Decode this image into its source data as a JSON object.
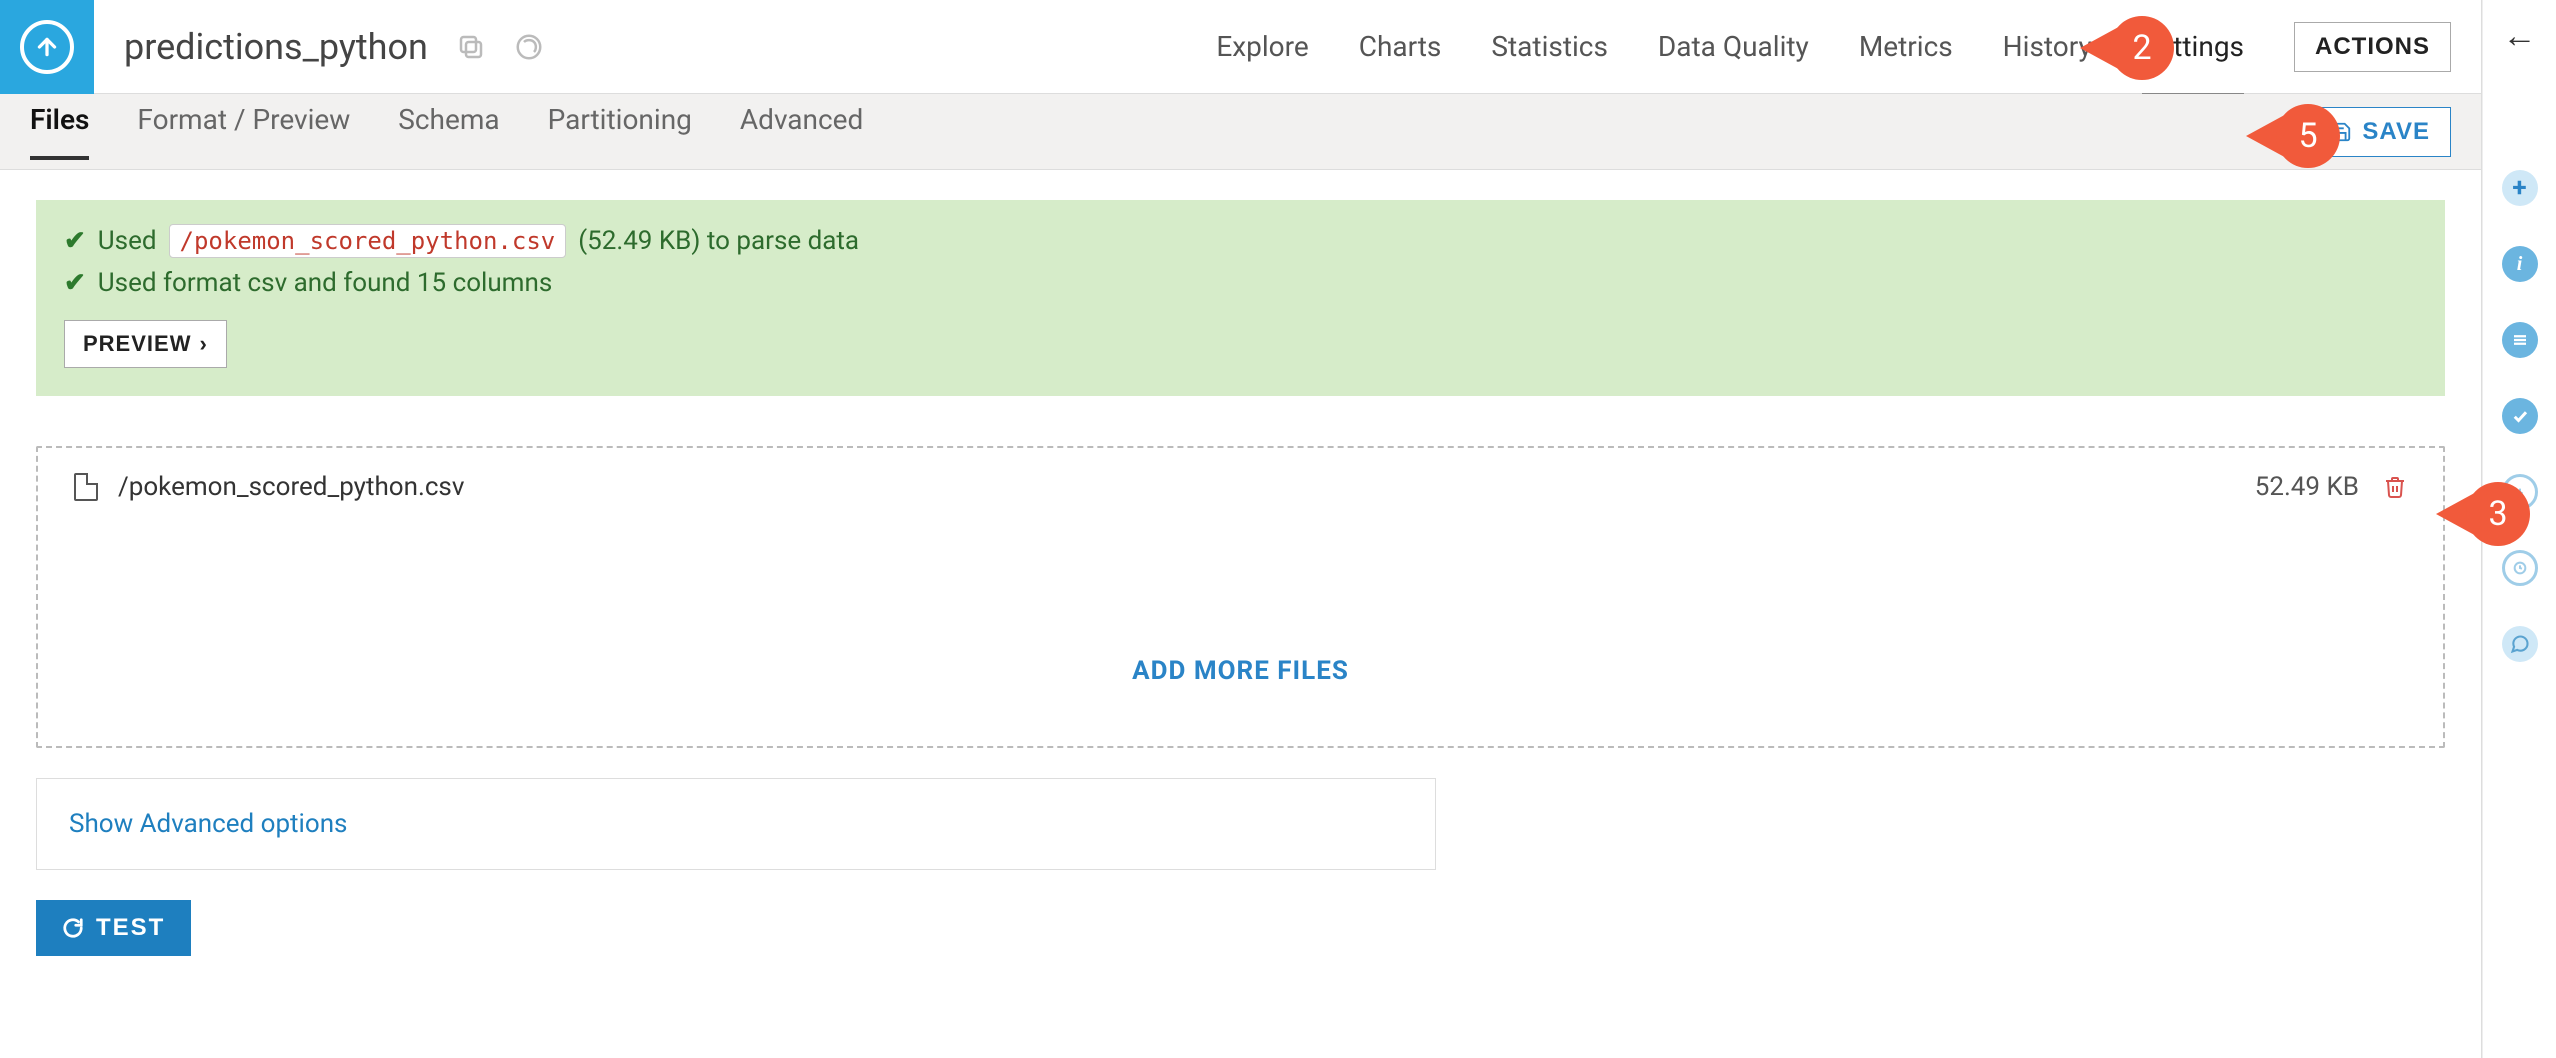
{
  "header": {
    "title": "predictions_python",
    "nav": [
      "Explore",
      "Charts",
      "Statistics",
      "Data Quality",
      "Metrics",
      "History",
      "Settings"
    ],
    "actions_label": "ACTIONS"
  },
  "tabs": {
    "items": [
      "Files",
      "Format / Preview",
      "Schema",
      "Partitioning",
      "Advanced"
    ],
    "active": "Files",
    "save_label": "SAVE"
  },
  "banner": {
    "line1_prefix": "Used",
    "line1_file": "/pokemon_scored_python.csv",
    "line1_suffix": "(52.49 KB) to parse data",
    "line2": "Used format csv and found 15 columns",
    "preview_label": "PREVIEW"
  },
  "files": {
    "items": [
      {
        "path": "/pokemon_scored_python.csv",
        "size": "52.49 KB"
      }
    ],
    "add_more_label": "ADD MORE FILES"
  },
  "advanced": {
    "link": "Show Advanced options"
  },
  "test": {
    "label": "TEST"
  },
  "callouts": {
    "c2": "2",
    "c3": "3",
    "c5": "5"
  }
}
